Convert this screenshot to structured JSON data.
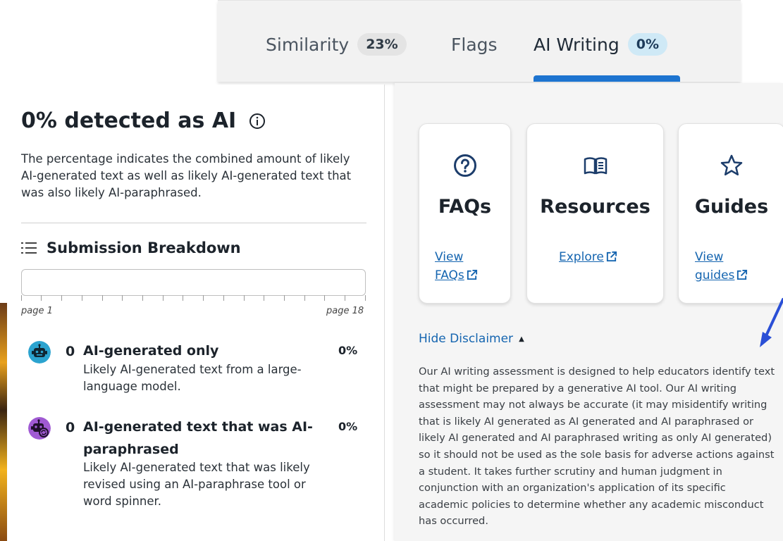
{
  "tabs": [
    {
      "label": "Similarity",
      "badge": "23%"
    },
    {
      "label": "Flags"
    },
    {
      "label": "AI Writing",
      "badge": "0%",
      "active": true
    }
  ],
  "ai_panel": {
    "heading": "0% detected as AI",
    "description": "The percentage indicates the combined amount of likely AI-generated text as well as likely AI-generated text that was also likely AI-paraphrased.",
    "breakdown_title": "Submission Breakdown",
    "page_start": "page 1",
    "page_end": "page 18",
    "categories": [
      {
        "count": "0",
        "name": "AI-generated only",
        "percent": "0%",
        "description": "Likely AI-generated text from a large-language model.",
        "icon": "robot-icon",
        "color": "#2ba3cf"
      },
      {
        "count": "0",
        "name": "AI-generated text that was AI-paraphrased",
        "percent": "0%",
        "description": "Likely AI-generated text that was likely revised using an AI-paraphrase tool or word spinner.",
        "icon": "robot-paraphrase-icon",
        "color": "#a05ad3"
      }
    ]
  },
  "resources": {
    "cards": [
      {
        "title": "FAQs",
        "link": "View FAQs",
        "icon": "question-circle-icon"
      },
      {
        "title": "Resources",
        "link": "Explore",
        "icon": "book-icon"
      },
      {
        "title": "Guides",
        "link": "View guides",
        "icon": "star-icon"
      }
    ]
  },
  "disclaimer": {
    "toggle_label": "Hide Disclaimer",
    "text": "Our AI writing assessment is designed to help educators identify text that might be prepared by a generative AI tool. Our AI writing assessment may not always be accurate (it may misidentify writing that is likely AI generated as AI generated and AI paraphrased or likely AI generated and AI paraphrased writing as only AI generated) so it should not be used as the sole basis for adverse actions against a student. It takes further scrutiny and human judgment in conjunction with an organization's application of its specific academic policies to determine whether any academic misconduct has occurred."
  },
  "colors": {
    "accent": "#1d74d0",
    "link": "#1565b0",
    "ai_badge_bg": "#cfe9f6"
  }
}
